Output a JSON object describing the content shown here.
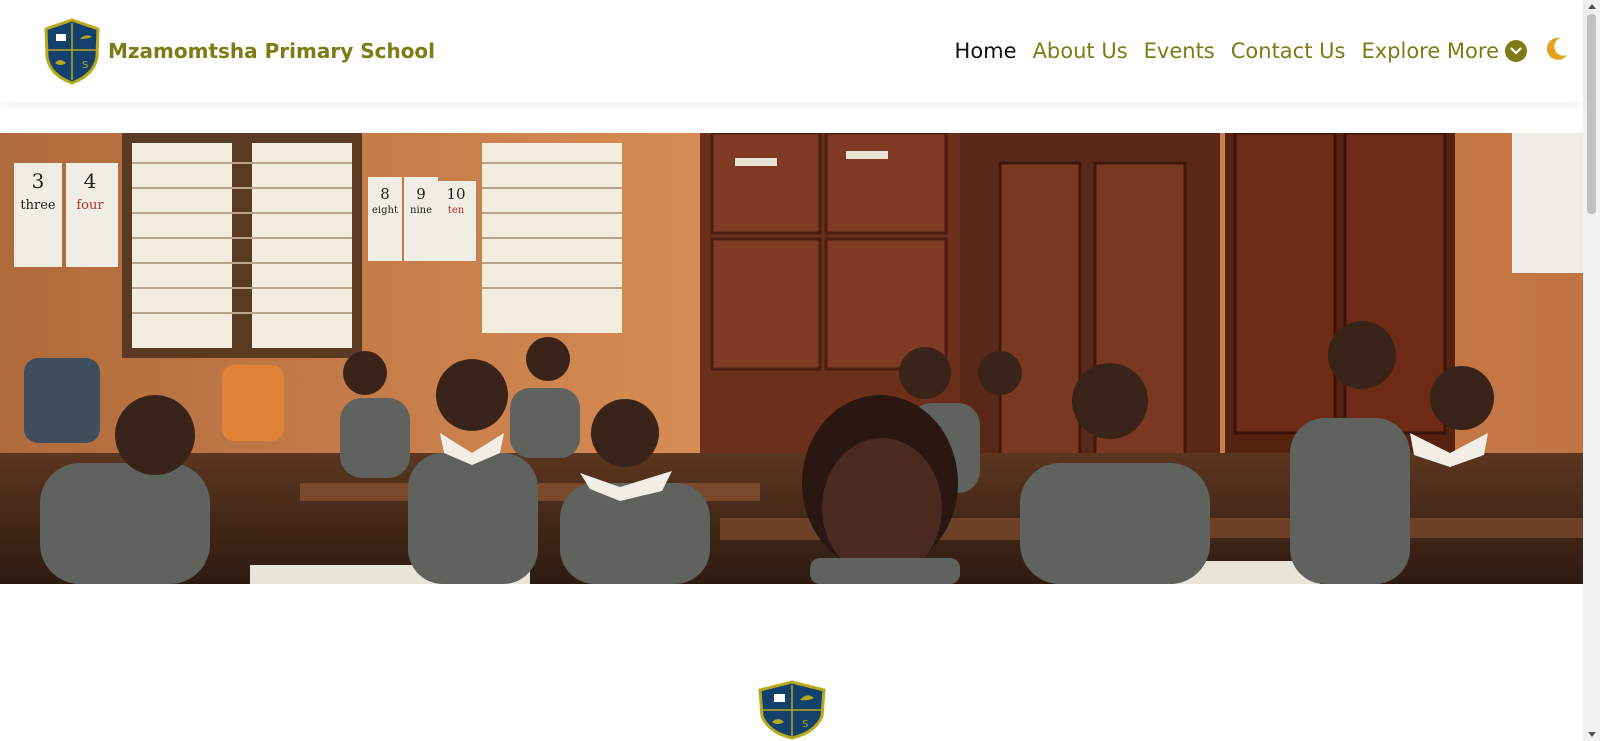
{
  "school": {
    "name": "Mzamomtsha Primary School"
  },
  "nav": {
    "items": [
      {
        "label": "Home",
        "active": true
      },
      {
        "label": "About Us",
        "active": false
      },
      {
        "label": "Events",
        "active": false
      },
      {
        "label": "Contact Us",
        "active": false
      }
    ],
    "explore_label": "Explore More",
    "theme_icon": "moon-icon"
  },
  "hero": {
    "alt": "Children in school uniforms seated at desks in a classroom",
    "classroom_cards": [
      "3",
      "three",
      "4",
      "four",
      "8",
      "eight",
      "9",
      "nine",
      "10",
      "ten"
    ]
  },
  "colors": {
    "brand": "#7e7a14",
    "shield_navy": "#14406e",
    "shield_gold": "#b7a91c",
    "moon": "#e3a21a"
  }
}
